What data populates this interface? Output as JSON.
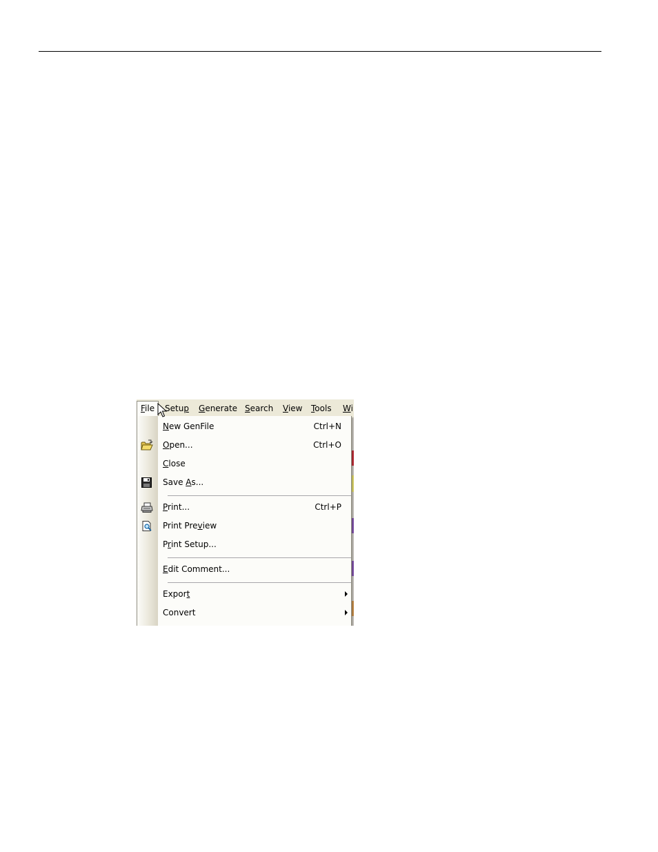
{
  "menubar": {
    "items": [
      {
        "id": "file",
        "mnemonic": "F",
        "rest": "ile",
        "open": true
      },
      {
        "id": "setup",
        "pre": "Setu",
        "mnemonic": "p",
        "rest": ""
      },
      {
        "id": "generate",
        "mnemonic": "G",
        "rest": "enerate"
      },
      {
        "id": "search",
        "mnemonic": "S",
        "rest": "earch"
      },
      {
        "id": "view",
        "mnemonic": "V",
        "rest": "iew"
      },
      {
        "id": "tools",
        "mnemonic": "T",
        "rest": "ools"
      },
      {
        "id": "window",
        "mnemonic": "W",
        "rest": "i"
      }
    ]
  },
  "file_menu": {
    "items": [
      {
        "id": "new-genfile",
        "pre": "",
        "mnemonic": "N",
        "rest": "ew GenFile",
        "shortcut": "Ctrl+N",
        "icon": ""
      },
      {
        "id": "open",
        "pre": "",
        "mnemonic": "O",
        "rest": "pen...",
        "shortcut": "Ctrl+O",
        "icon": "open-folder-icon"
      },
      {
        "id": "close",
        "pre": "",
        "mnemonic": "C",
        "rest": "lose",
        "shortcut": "",
        "icon": ""
      },
      {
        "id": "save-as",
        "pre": "Save ",
        "mnemonic": "A",
        "rest": "s...",
        "shortcut": "",
        "icon": "floppy-disk-icon"
      },
      {
        "id": "print",
        "pre": "",
        "mnemonic": "P",
        "rest": "rint...",
        "shortcut": "Ctrl+P",
        "icon": "printer-icon"
      },
      {
        "id": "print-preview",
        "pre": "Print Pre",
        "mnemonic": "v",
        "rest": "iew",
        "shortcut": "",
        "icon": "print-preview-icon"
      },
      {
        "id": "print-setup",
        "pre": "P",
        "mnemonic": "r",
        "rest": "int Setup...",
        "shortcut": "",
        "icon": ""
      },
      {
        "id": "edit-comment",
        "pre": "",
        "mnemonic": "E",
        "rest": "dit Comment...",
        "shortcut": "",
        "icon": ""
      },
      {
        "id": "export",
        "pre": "Expor",
        "mnemonic": "t",
        "rest": "",
        "shortcut": "",
        "icon": "",
        "submenu": true
      },
      {
        "id": "convert",
        "pre": "Convert",
        "mnemonic": "",
        "rest": "",
        "shortcut": "",
        "icon": "",
        "submenu": true
      }
    ]
  },
  "colors": {
    "menubar_bg": "#ece9d8",
    "menu_bg": "#fcfcf9",
    "menu_border": "#8f8d80",
    "bg_strip_red": "#c8323c",
    "bg_strip_yellow": "#e8e070",
    "bg_strip_purple": "#8a5ab4",
    "bg_strip_orange": "#d29650"
  }
}
